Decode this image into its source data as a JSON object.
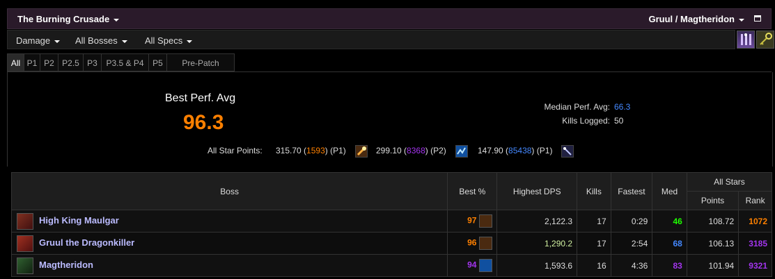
{
  "header": {
    "expansion": "The Burning Crusade",
    "zone": "Gruul / Magtheridon"
  },
  "filters": {
    "metric": "Damage",
    "bosses": "All Bosses",
    "specs": "All Specs"
  },
  "tabs": [
    "All",
    "P1",
    "P2",
    "P2.5",
    "P3",
    "P3.5 & P4",
    "P5",
    "Pre-Patch"
  ],
  "active_tab": "All",
  "summary": {
    "best_perf_label": "Best Perf. Avg",
    "best_perf_value": "96.3",
    "median_label": "Median Perf. Avg:",
    "median_value": "66.3",
    "kills_label": "Kills Logged:",
    "kills_value": "50",
    "stars_label": "All Star Points:",
    "stars": [
      {
        "points": "315.70",
        "rank": "1593",
        "phase": "(P1)",
        "color": "#ff8000"
      },
      {
        "points": "299.10",
        "rank": "8368",
        "phase": "(P2)",
        "color": "#a335ee"
      },
      {
        "points": "147.90",
        "rank": "85438",
        "phase": "(P1)",
        "color": "#4488ff"
      }
    ]
  },
  "table": {
    "headers": {
      "boss": "Boss",
      "best": "Best %",
      "dps": "Highest DPS",
      "kills": "Kills",
      "fastest": "Fastest",
      "med": "Med",
      "allstars": "All Stars",
      "points": "Points",
      "rank": "Rank"
    },
    "rows": [
      {
        "boss": "High King Maulgar",
        "best": "97",
        "best_color": "#ff8000",
        "dps": "2,122.3",
        "dps_color": "#dddddd",
        "kills": "17",
        "fastest": "0:29",
        "med": "46",
        "med_color": "#1eff00",
        "points": "108.72",
        "rank": "1072",
        "rank_color": "#ff8000"
      },
      {
        "boss": "Gruul the Dragonkiller",
        "best": "96",
        "best_color": "#ff8000",
        "dps": "1,290.2",
        "dps_color": "#d0f0a0",
        "kills": "17",
        "fastest": "2:54",
        "med": "68",
        "med_color": "#4488ff",
        "points": "106.13",
        "rank": "3185",
        "rank_color": "#a335ee"
      },
      {
        "boss": "Magtheridon",
        "best": "94",
        "best_color": "#a335ee",
        "dps": "1,593.6",
        "dps_color": "#dddddd",
        "kills": "16",
        "fastest": "4:36",
        "med": "83",
        "med_color": "#a335ee",
        "points": "101.94",
        "rank": "9321",
        "rank_color": "#a335ee"
      }
    ]
  }
}
